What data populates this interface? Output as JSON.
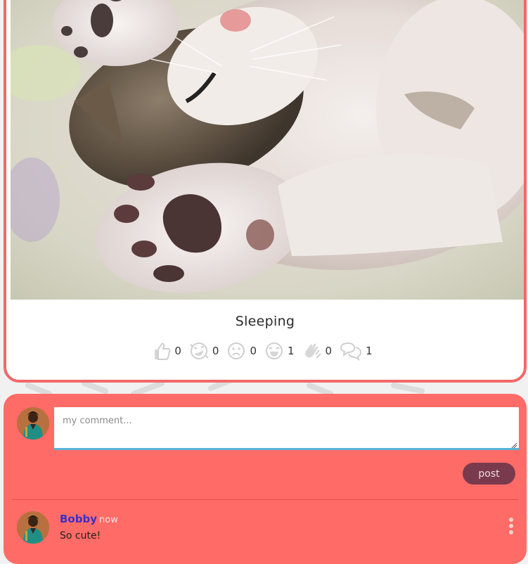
{
  "post": {
    "title": "Sleeping",
    "image": "sleeping-kitten-photo",
    "reactions": [
      {
        "icon": "thumbs-up-icon",
        "count": "0"
      },
      {
        "icon": "laughing-face-icon",
        "count": "0"
      },
      {
        "icon": "sad-face-icon",
        "count": "0"
      },
      {
        "icon": "heart-eyes-face-icon",
        "count": "1"
      },
      {
        "icon": "clapping-hands-icon",
        "count": "0"
      },
      {
        "icon": "comments-icon",
        "count": "1"
      }
    ]
  },
  "comment_form": {
    "placeholder": "my comment...",
    "value": "",
    "post_label": "post"
  },
  "comments": [
    {
      "author": "Bobby",
      "time": "now",
      "text": "So cute!"
    }
  ],
  "colors": {
    "accent": "#ff6b66",
    "card_border": "#f36868",
    "post_button": "#7a3a4e",
    "author": "#3a2fc9",
    "input_underline": "#5ab3d8"
  }
}
